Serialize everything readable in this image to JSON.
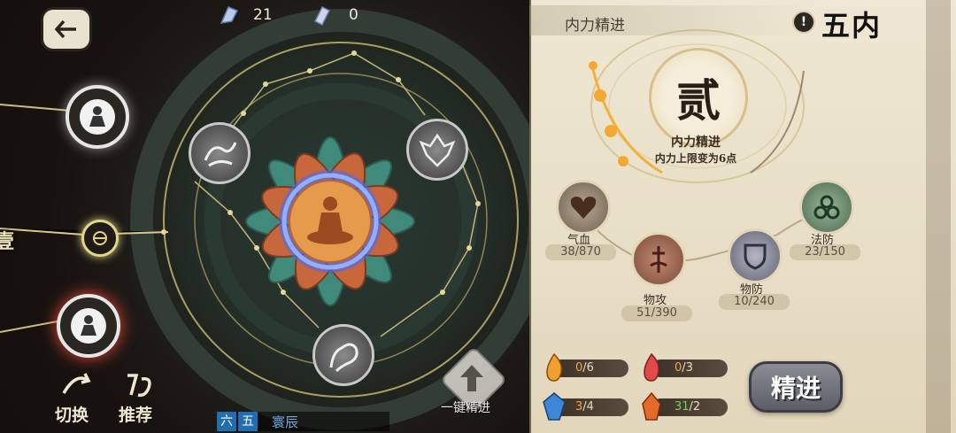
{
  "topbar": {
    "currency1_value": "21",
    "currency2_value": "0",
    "currency1_icon": "crystal-feather-icon",
    "currency2_icon": "jade-token-icon"
  },
  "left": {
    "left_edge_label": "壹",
    "switch_button_label": "切换",
    "recommend_button_label": "推荐",
    "one_click_button_label": "一键精进",
    "tabs": [
      {
        "label": "六",
        "active": true
      },
      {
        "label": "五",
        "active": true
      }
    ],
    "tab_caption": "寰辰"
  },
  "panel": {
    "header_title": "内力精进",
    "corner_title": "五内",
    "big_seal": "贰",
    "seal_title": "内力精进",
    "seal_desc": "内力上限变为6点",
    "stats": [
      {
        "name": "气血",
        "value": "38/870"
      },
      {
        "name": "物攻",
        "value": "51/390"
      },
      {
        "name": "物防",
        "value": "10/240"
      },
      {
        "name": "法防",
        "value": "23/150"
      }
    ],
    "resources": [
      {
        "current": "0",
        "total": "/6",
        "icon": "orange-flame-icon"
      },
      {
        "current": "0",
        "total": "/3",
        "icon": "red-flame-icon"
      },
      {
        "current": "3",
        "total": "/4",
        "icon": "blue-crystal-icon"
      },
      {
        "current": "31",
        "total": "/2",
        "icon": "fire-crystal-icon"
      }
    ],
    "refine_button_label": "精进",
    "colors": {
      "accent_gold": "#d8b86a",
      "highlight_orange": "#f2a53c",
      "highlight_green": "#6ad25b",
      "parchment": "#ece3cd"
    }
  }
}
